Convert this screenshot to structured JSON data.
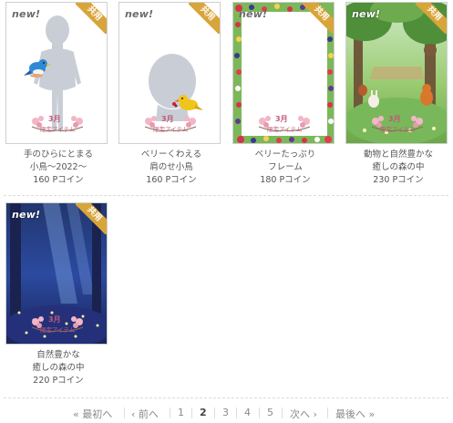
{
  "items": [
    {
      "new_label": "new!",
      "ribbon_label": "共用",
      "badge_month": "3月",
      "badge_limited": "限定アイテム",
      "title_line1": "手のひらにとまる",
      "title_line2": "小鳥～2022～",
      "price": "160 Pコイン"
    },
    {
      "new_label": "new!",
      "ribbon_label": "共用",
      "badge_month": "3月",
      "badge_limited": "限定アイテム",
      "title_line1": "ベリーくわえる",
      "title_line2": "肩のせ小鳥",
      "price": "160 Pコイン"
    },
    {
      "new_label": "new!",
      "ribbon_label": "共用",
      "badge_month": "3月",
      "badge_limited": "限定アイテム",
      "title_line1": "ベリーたっぷり",
      "title_line2": "フレーム",
      "price": "180 Pコイン"
    },
    {
      "new_label": "new!",
      "ribbon_label": "共用",
      "badge_month": "3月",
      "badge_limited": "限定アイテム",
      "title_line1": "動物と自然豊かな",
      "title_line2": "癒しの森の中",
      "price": "230 Pコイン"
    },
    {
      "new_label": "new!",
      "ribbon_label": "共用",
      "badge_month": "3月",
      "badge_limited": "限定アイテム",
      "title_line1": "自然豊かな",
      "title_line2": "癒しの森の中",
      "price": "220 Pコイン"
    }
  ],
  "pagination": {
    "first": "« 最初へ",
    "prev": "‹ 前へ",
    "pages": [
      "1",
      "2",
      "3",
      "4",
      "5"
    ],
    "current_page": "2",
    "next": "次へ ›",
    "last": "最後へ »"
  },
  "colors": {
    "ribbon": "#d8a53a",
    "badge_text": "#c0587a",
    "divider": "#dcdcdc",
    "pagination_text": "#8a8a8a"
  }
}
